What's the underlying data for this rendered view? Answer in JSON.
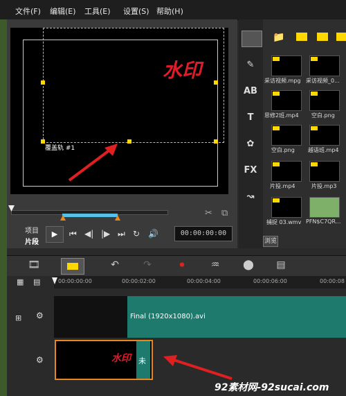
{
  "menu": {
    "file": "文件(F)",
    "edit": "编辑(E)",
    "tools": "工具(E)",
    "settings": "设置(S)",
    "help": "帮助(H)"
  },
  "preview": {
    "watermark_text": "水印",
    "track_label": "覆盖轨 #1"
  },
  "transport": {
    "project_label": "项目",
    "clip_label": "片段",
    "timecode": "00:00:00:00"
  },
  "library": {
    "items": [
      {
        "label": "采访视频.mpg"
      },
      {
        "label": "采访视频_0..."
      },
      {
        "label": "思修2班.mp4"
      },
      {
        "label": "空白.png"
      },
      {
        "label": "空白.png"
      },
      {
        "label": "越语班.mp4"
      },
      {
        "label": "片投.mp4"
      },
      {
        "label": "片投.mp3"
      },
      {
        "label": "捕捉 03.wmv"
      },
      {
        "label": "PFN$C7QR..."
      }
    ],
    "browse_button": "浏览"
  },
  "timeline": {
    "ticks": [
      "00:00:00:00",
      "00:00:02:00",
      "00:00:04:00",
      "00:00:06:00",
      "00:00:08"
    ],
    "clip_final": "Final (1920x1080).avi",
    "clip_watermark": "水印",
    "clip_watermark_tail": "未",
    "footer_watermark": "92素材网-92sucai.com"
  },
  "colors": {
    "accent_yellow": "#ffd800",
    "clip_teal": "#1f7a6e",
    "clip_border_orange": "#e8871e",
    "arrow_red": "#e02020"
  }
}
